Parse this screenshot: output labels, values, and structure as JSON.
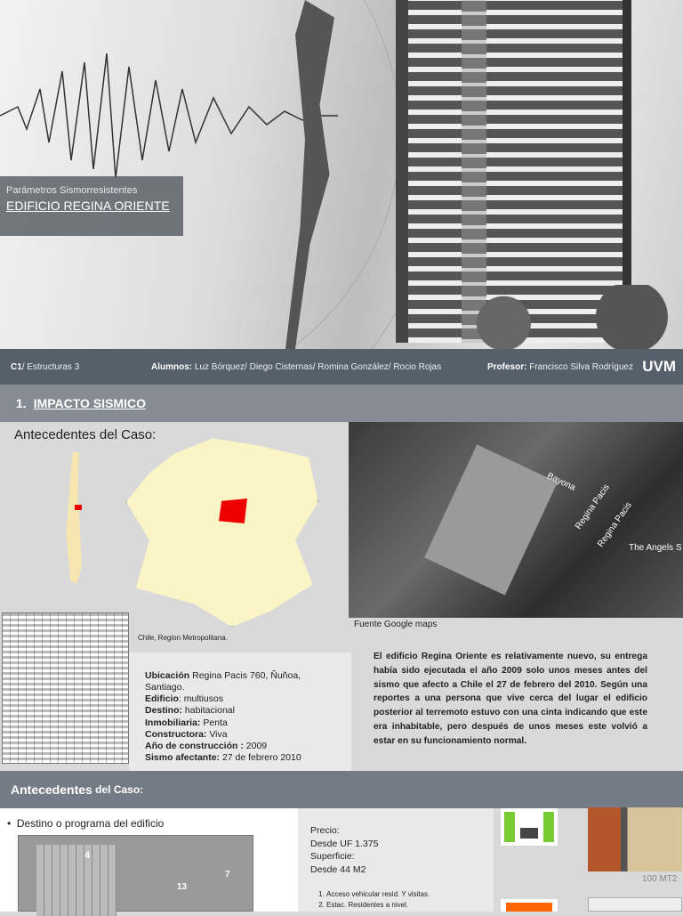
{
  "hero": {
    "subtitle": "Parámetros Sismorresistentes",
    "title": "EDIFICIO REGINA ORIENTE"
  },
  "footer": {
    "course_code": "C1",
    "course": "/ Estructuras 3",
    "students_label": "Alumnos:",
    "students": " Luz Bórquez/ Diego Cisternas/ Romina González/ Rocio Rojas",
    "professor_label": "Profesor:",
    "professor": " Francisco Silva Rodríguez",
    "logo": "UVM"
  },
  "section1": {
    "number": "1.",
    "title": "IMPACTO SISMICO"
  },
  "case": {
    "heading": "Antecedentes del Caso:",
    "map_caption": "Chile, Region Metropolitana.",
    "satellite_caption": "Fuente Google maps",
    "map_labels": [
      "Bayona",
      "Regina Pacis",
      "Regina Pacis",
      "The Angels S"
    ]
  },
  "info": [
    {
      "label": "Ubicación",
      "value": " Regina Pacis 760, Ñuñoa, Santiago."
    },
    {
      "label": "Edificio",
      "value": ": multiusos"
    },
    {
      "label": "Destino:",
      "value": " habitacional"
    },
    {
      "label": "Inmobiliaria:",
      "value": " Penta"
    },
    {
      "label": "Constructora:",
      "value": " Viva"
    },
    {
      "label": "Año de construcción :",
      "value": " 2009"
    },
    {
      "label": "Sismo afectante:",
      "value": " 27 de febrero 2010"
    }
  ],
  "paragraph": "El edificio Regina Oriente es relativamente nuevo, su entrega había sido ejecutada el año 2009 solo unos meses antes del sismo que afecto a Chile el 27 de febrero del 2010.  Según una reportes a una persona que vive cerca del lugar el edificio posterior al terremoto estuvo con una cinta indicando que este era inhabitable, pero después de unos meses este volvió a estar en su funcionamiento normal.",
  "section2": {
    "title_a": "Antecedentes",
    "title_b": " del Caso:"
  },
  "program": {
    "bullet": "Destino o programa del edificio",
    "site_numbers": [
      "4",
      "13",
      "7"
    ]
  },
  "price": {
    "price_label": "Precio:",
    "price_value": "Desde UF 1.375",
    "area_label": "Superficie:",
    "area_value": "Desde 44 M2",
    "list": [
      "Acceso vehicular resid. Y visitas.",
      "Estac. Residentes a nivel."
    ]
  },
  "plans": {
    "plan1_area": "100 MT2"
  }
}
